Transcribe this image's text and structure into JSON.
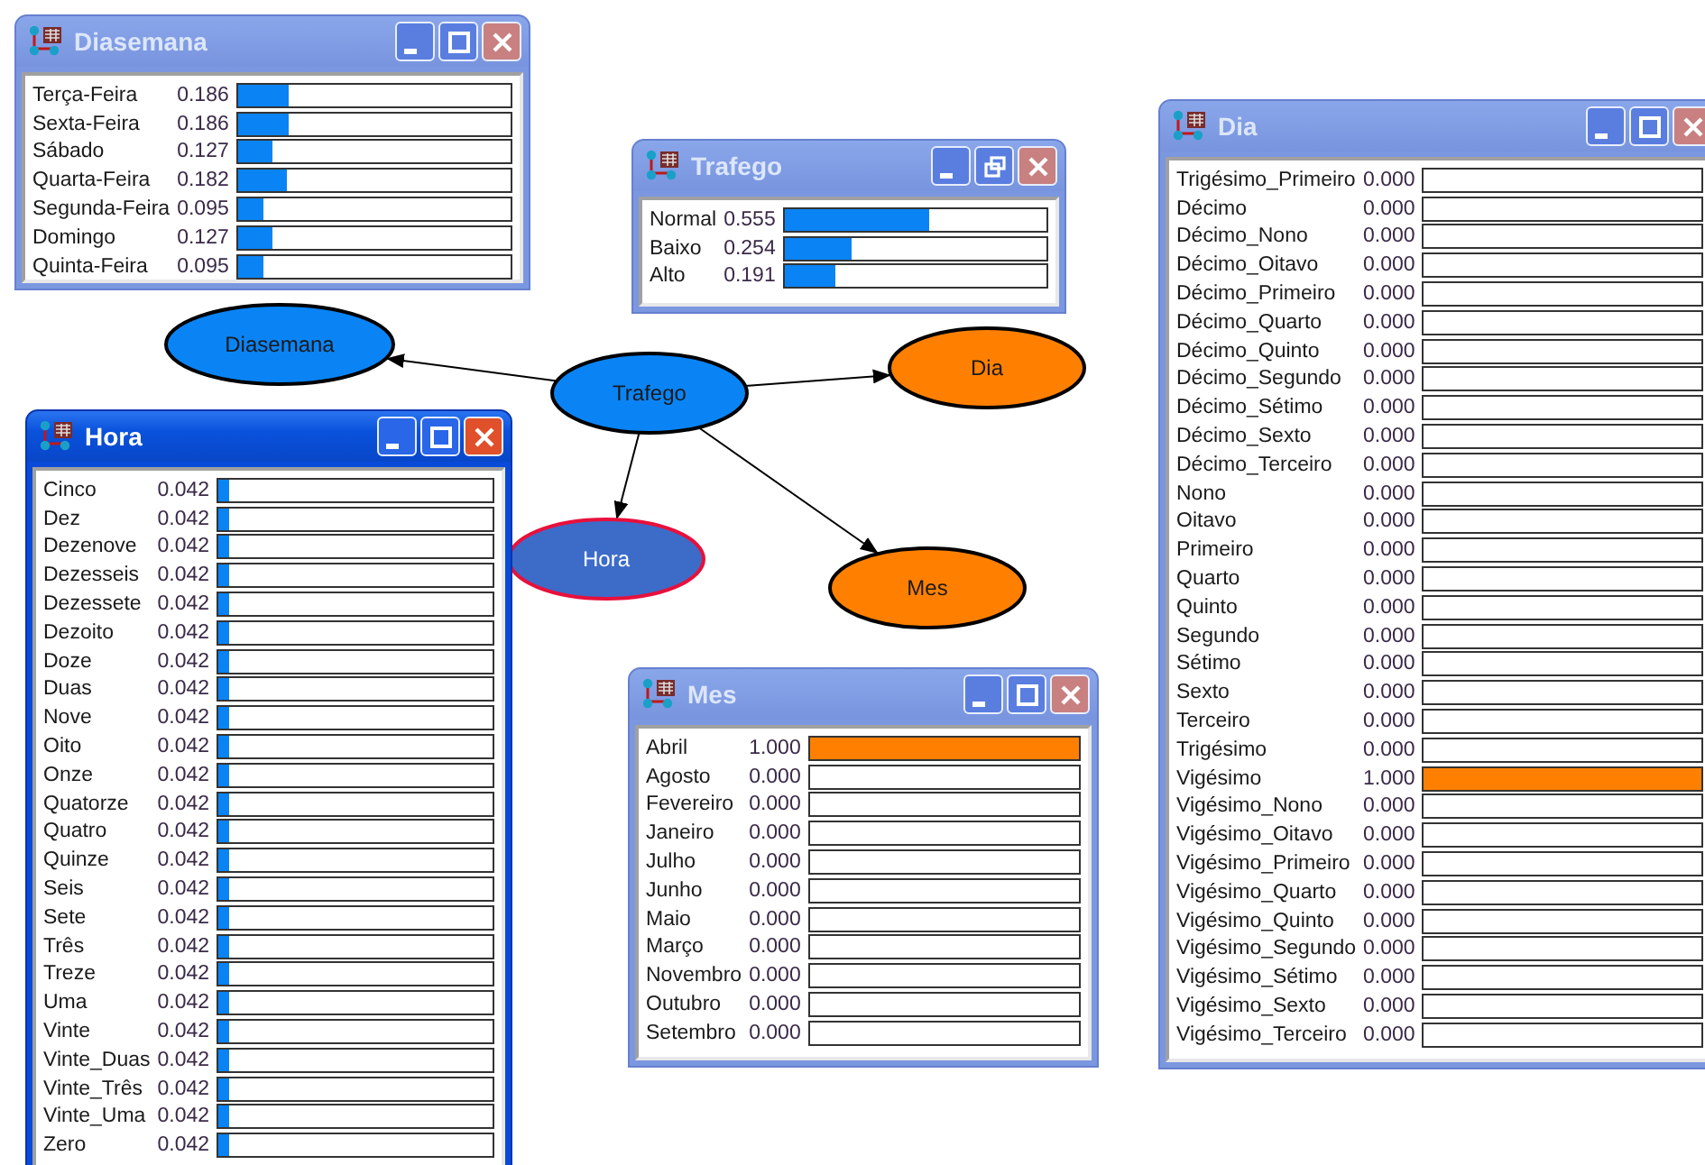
{
  "windows": [
    {
      "title": "Diasemana",
      "active": false,
      "evidence": false,
      "restore_button": false,
      "states": [
        {
          "name": "Terça-Feira",
          "value": "0.186",
          "level": 0.186
        },
        {
          "name": "Sexta-Feira",
          "value": "0.186",
          "level": 0.186
        },
        {
          "name": "Sábado",
          "value": "0.127",
          "level": 0.127
        },
        {
          "name": "Quarta-Feira",
          "value": "0.182",
          "level": 0.182
        },
        {
          "name": "Segunda-Feira",
          "value": "0.095",
          "level": 0.095
        },
        {
          "name": "Domingo",
          "value": "0.127",
          "level": 0.127
        },
        {
          "name": "Quinta-Feira",
          "value": "0.095",
          "level": 0.095
        }
      ]
    },
    {
      "title": "Trafego",
      "active": false,
      "evidence": false,
      "restore_button": true,
      "states": [
        {
          "name": "Normal",
          "value": "0.555",
          "level": 0.555
        },
        {
          "name": "Baixo",
          "value": "0.254",
          "level": 0.254
        },
        {
          "name": "Alto",
          "value": "0.191",
          "level": 0.191
        }
      ]
    },
    {
      "title": "Dia",
      "active": false,
      "evidence": true,
      "restore_button": false,
      "states": [
        {
          "name": "Trigésimo_Primeiro",
          "value": "0.000",
          "level": 0
        },
        {
          "name": "Décimo",
          "value": "0.000",
          "level": 0
        },
        {
          "name": "Décimo_Nono",
          "value": "0.000",
          "level": 0
        },
        {
          "name": "Décimo_Oitavo",
          "value": "0.000",
          "level": 0
        },
        {
          "name": "Décimo_Primeiro",
          "value": "0.000",
          "level": 0
        },
        {
          "name": "Décimo_Quarto",
          "value": "0.000",
          "level": 0
        },
        {
          "name": "Décimo_Quinto",
          "value": "0.000",
          "level": 0
        },
        {
          "name": "Décimo_Segundo",
          "value": "0.000",
          "level": 0
        },
        {
          "name": "Décimo_Sétimo",
          "value": "0.000",
          "level": 0
        },
        {
          "name": "Décimo_Sexto",
          "value": "0.000",
          "level": 0
        },
        {
          "name": "Décimo_Terceiro",
          "value": "0.000",
          "level": 0
        },
        {
          "name": "Nono",
          "value": "0.000",
          "level": 0
        },
        {
          "name": "Oitavo",
          "value": "0.000",
          "level": 0
        },
        {
          "name": "Primeiro",
          "value": "0.000",
          "level": 0
        },
        {
          "name": "Quarto",
          "value": "0.000",
          "level": 0
        },
        {
          "name": "Quinto",
          "value": "0.000",
          "level": 0
        },
        {
          "name": "Segundo",
          "value": "0.000",
          "level": 0
        },
        {
          "name": "Sétimo",
          "value": "0.000",
          "level": 0
        },
        {
          "name": "Sexto",
          "value": "0.000",
          "level": 0
        },
        {
          "name": "Terceiro",
          "value": "0.000",
          "level": 0
        },
        {
          "name": "Trigésimo",
          "value": "0.000",
          "level": 0
        },
        {
          "name": "Vigésimo",
          "value": "1.000",
          "level": 1
        },
        {
          "name": "Vigésimo_Nono",
          "value": "0.000",
          "level": 0
        },
        {
          "name": "Vigésimo_Oitavo",
          "value": "0.000",
          "level": 0
        },
        {
          "name": "Vigésimo_Primeiro",
          "value": "0.000",
          "level": 0
        },
        {
          "name": "Vigésimo_Quarto",
          "value": "0.000",
          "level": 0
        },
        {
          "name": "Vigésimo_Quinto",
          "value": "0.000",
          "level": 0
        },
        {
          "name": "Vigésimo_Segundo",
          "value": "0.000",
          "level": 0
        },
        {
          "name": "Vigésimo_Sétimo",
          "value": "0.000",
          "level": 0
        },
        {
          "name": "Vigésimo_Sexto",
          "value": "0.000",
          "level": 0
        },
        {
          "name": "Vigésimo_Terceiro",
          "value": "0.000",
          "level": 0
        }
      ]
    },
    {
      "title": "Hora",
      "active": true,
      "evidence": false,
      "restore_button": false,
      "states": [
        {
          "name": "Cinco",
          "value": "0.042",
          "level": 0.042
        },
        {
          "name": "Dez",
          "value": "0.042",
          "level": 0.042
        },
        {
          "name": "Dezenove",
          "value": "0.042",
          "level": 0.042
        },
        {
          "name": "Dezesseis",
          "value": "0.042",
          "level": 0.042
        },
        {
          "name": "Dezessete",
          "value": "0.042",
          "level": 0.042
        },
        {
          "name": "Dezoito",
          "value": "0.042",
          "level": 0.042
        },
        {
          "name": "Doze",
          "value": "0.042",
          "level": 0.042
        },
        {
          "name": "Duas",
          "value": "0.042",
          "level": 0.042
        },
        {
          "name": "Nove",
          "value": "0.042",
          "level": 0.042
        },
        {
          "name": "Oito",
          "value": "0.042",
          "level": 0.042
        },
        {
          "name": "Onze",
          "value": "0.042",
          "level": 0.042
        },
        {
          "name": "Quatorze",
          "value": "0.042",
          "level": 0.042
        },
        {
          "name": "Quatro",
          "value": "0.042",
          "level": 0.042
        },
        {
          "name": "Quinze",
          "value": "0.042",
          "level": 0.042
        },
        {
          "name": "Seis",
          "value": "0.042",
          "level": 0.042
        },
        {
          "name": "Sete",
          "value": "0.042",
          "level": 0.042
        },
        {
          "name": "Três",
          "value": "0.042",
          "level": 0.042
        },
        {
          "name": "Treze",
          "value": "0.042",
          "level": 0.042
        },
        {
          "name": "Uma",
          "value": "0.042",
          "level": 0.042
        },
        {
          "name": "Vinte",
          "value": "0.042",
          "level": 0.042
        },
        {
          "name": "Vinte_Duas",
          "value": "0.042",
          "level": 0.042
        },
        {
          "name": "Vinte_Três",
          "value": "0.042",
          "level": 0.042
        },
        {
          "name": "Vinte_Uma",
          "value": "0.042",
          "level": 0.042
        },
        {
          "name": "Zero",
          "value": "0.042",
          "level": 0.042
        }
      ]
    },
    {
      "title": "Mes",
      "active": false,
      "evidence": true,
      "restore_button": false,
      "states": [
        {
          "name": "Abril",
          "value": "1.000",
          "level": 1
        },
        {
          "name": "Agosto",
          "value": "0.000",
          "level": 0
        },
        {
          "name": "Fevereiro",
          "value": "0.000",
          "level": 0
        },
        {
          "name": "Janeiro",
          "value": "0.000",
          "level": 0
        },
        {
          "name": "Julho",
          "value": "0.000",
          "level": 0
        },
        {
          "name": "Junho",
          "value": "0.000",
          "level": 0
        },
        {
          "name": "Maio",
          "value": "0.000",
          "level": 0
        },
        {
          "name": "Março",
          "value": "0.000",
          "level": 0
        },
        {
          "name": "Novembro",
          "value": "0.000",
          "level": 0
        },
        {
          "name": "Outubro",
          "value": "0.000",
          "level": 0
        },
        {
          "name": "Setembro",
          "value": "0.000",
          "level": 0
        }
      ]
    }
  ],
  "network": {
    "name": "Trafego",
    "color": "#0a84f5",
    "selected": false,
    "children": [
      {
        "name": "Diasemana",
        "color": "#0a84f5",
        "selected": false
      },
      {
        "name": "Dia",
        "color": "#ff8000",
        "selected": false
      },
      {
        "name": "Hora",
        "color": "#3c6cc8",
        "selected": true
      },
      {
        "name": "Mes",
        "color": "#ff8000",
        "selected": false
      }
    ]
  }
}
